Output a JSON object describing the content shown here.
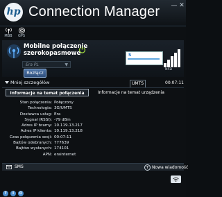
{
  "window": {
    "title": "Connection Manager",
    "logo_text": "hp",
    "controls": {
      "minimize": "—",
      "close": "✕"
    }
  },
  "modes": [
    {
      "label": "MBB",
      "icon": "mobile-broadband-icon"
    },
    {
      "label": "GPS",
      "icon": "gps-icon"
    }
  ],
  "connection": {
    "title": "Mobilne połączenie szerokopasmowe",
    "operator_select": "Era PL",
    "disconnect_label": "Rozłącz",
    "signal_label": "Era",
    "operator_logo_text": "S",
    "signal_bars": 5
  },
  "details": {
    "toggle_label": "Mniej szczegółów",
    "technology_badge": "UMTS",
    "timer": "00:07:11"
  },
  "tabs": {
    "connection_info": "Informacje na temat połączenia",
    "device_info": "Informacje na temat urządzenia"
  },
  "info_rows": [
    {
      "key": "Stan połączenia:",
      "value": "Połączony"
    },
    {
      "key": "Technologia:",
      "value": "3G/UMTS"
    },
    {
      "key": "Dostawca usług:",
      "value": "Era"
    },
    {
      "key": "Sygnał (RSSI):",
      "value": "-79 dBm"
    },
    {
      "key": "Adres IP bramy:",
      "value": "10.119.13.217"
    },
    {
      "key": "Adres IP klienta:",
      "value": "10.119.13.218"
    },
    {
      "key": "Czas połączenia sesji:",
      "value": "00:07:11"
    },
    {
      "key": "Bajtów odebranych:",
      "value": "777639"
    },
    {
      "key": "Bajtów wysłanych:",
      "value": "174101"
    },
    {
      "key": "APN:",
      "value": "erainternet"
    }
  ],
  "sms": {
    "label": "SMS",
    "new_message": "Nowa wiadomość"
  },
  "colors": {
    "background": "#0d1013",
    "accent": "#4a8fd0",
    "power_icon": "#9ad13d"
  }
}
